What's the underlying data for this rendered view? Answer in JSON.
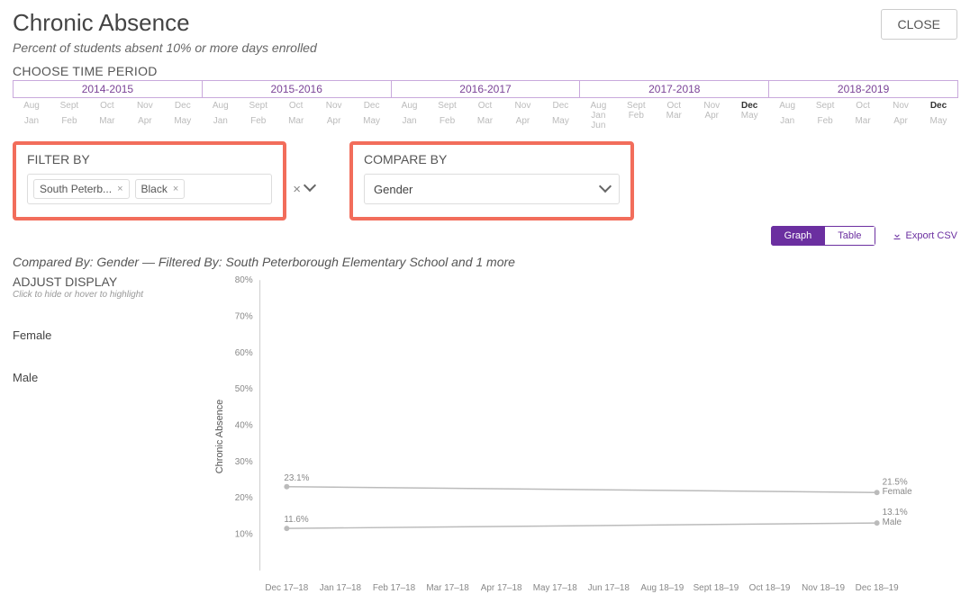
{
  "header": {
    "title": "Chronic Absence",
    "subtitle": "Percent of students absent 10% or more days enrolled",
    "close": "CLOSE"
  },
  "time": {
    "label": "CHOOSE TIME PERIOD",
    "years": [
      "2014-2015",
      "2015-2016",
      "2016-2017",
      "2017-2018",
      "2018-2019"
    ],
    "months_row1": [
      "Aug",
      "Sept",
      "Oct",
      "Nov",
      "Dec"
    ],
    "months_row2": [
      "Jan",
      "Feb",
      "Mar",
      "Apr",
      "May"
    ],
    "selected_start": "Dec",
    "selected_end": "Dec",
    "jun_label": "Jun"
  },
  "filter": {
    "title": "FILTER BY",
    "chips": [
      "South Peterb...",
      "Black"
    ]
  },
  "compare": {
    "title": "COMPARE BY",
    "value": "Gender"
  },
  "toolbar": {
    "graph": "Graph",
    "table": "Table",
    "export": "Export CSV"
  },
  "summary": "Compared By: Gender — Filtered By: South Peterborough Elementary School and 1 more",
  "adjust": {
    "title": "ADJUST DISPLAY",
    "hint": "Click to hide or hover to highlight",
    "legend": [
      "Female",
      "Male"
    ]
  },
  "chart_data": {
    "type": "line",
    "title": "",
    "xlabel": "",
    "ylabel": "Chronic Absence",
    "ylim": [
      0,
      80
    ],
    "y_ticks": [
      80,
      70,
      60,
      50,
      40,
      30,
      20,
      10
    ],
    "categories": [
      "Dec 17–18",
      "Jan 17–18",
      "Feb 17–18",
      "Mar 17–18",
      "Apr 17–18",
      "May 17–18",
      "Jun 17–18",
      "Aug 18–19",
      "Sept 18–19",
      "Oct 18–19",
      "Nov 18–19",
      "Dec 18–19"
    ],
    "series": [
      {
        "name": "Female",
        "values": [
          23.1,
          null,
          null,
          null,
          null,
          null,
          null,
          null,
          null,
          null,
          null,
          21.5
        ],
        "start_label": "23.1%",
        "end_label": "21.5%",
        "end_name": "Female"
      },
      {
        "name": "Male",
        "values": [
          11.6,
          null,
          null,
          null,
          null,
          null,
          null,
          null,
          null,
          null,
          null,
          13.1
        ],
        "start_label": "11.6%",
        "end_label": "13.1%",
        "end_name": "Male"
      }
    ]
  }
}
